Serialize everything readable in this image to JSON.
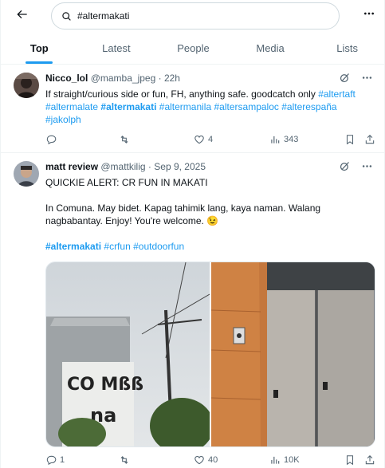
{
  "search": {
    "value": "#altermakati"
  },
  "tabs": [
    {
      "label": "Top",
      "active": true
    },
    {
      "label": "Latest",
      "active": false
    },
    {
      "label": "People",
      "active": false
    },
    {
      "label": "Media",
      "active": false
    },
    {
      "label": "Lists",
      "active": false
    }
  ],
  "tweets": [
    {
      "name": "Nicco_lol",
      "handle": "@mamba_jpeg",
      "dot": "·",
      "time": "22h",
      "text_line1": "If straight/curious side or fun, FH,  anything safe. goodcatch only ",
      "tags": [
        "#altertaft",
        "#altermalate",
        "#altermakati",
        "#altermanila",
        "#altersampaloc",
        "#alterespaña",
        "#jakolph"
      ],
      "reply_count": "",
      "retweet_count": "",
      "like_count": "4",
      "view_count": "343"
    },
    {
      "name": "matt review",
      "handle": "@mattkilig",
      "dot": "·",
      "time": "Sep 9, 2025",
      "line1": "QUICKIE ALERT: CR FUN IN MAKATI",
      "line2": "In Comuna. May bidet. Kapag tahimik lang, kaya naman. Walang",
      "line3": "nagbabantay. Enjoy! You're welcome. 😉",
      "tags": [
        "#altermakati",
        "#crfun",
        "#outdoorfun"
      ],
      "media_sign_line1": "CO Mßß",
      "media_sign_line2": "na",
      "reply_count": "1",
      "retweet_count": "",
      "like_count": "40",
      "view_count": "10K"
    }
  ],
  "icons": {
    "back": "arrow-left-icon",
    "search": "search-icon",
    "more": "more-horizontal-icon",
    "grok": "grok-icon",
    "reply": "reply-icon",
    "retweet": "retweet-icon",
    "like": "heart-icon",
    "views": "analytics-icon",
    "bookmark": "bookmark-icon",
    "share": "share-icon"
  },
  "colors": {
    "accent": "#1d9bf0",
    "text": "#0f1419",
    "muted": "#536471",
    "border": "#eff3f4"
  }
}
